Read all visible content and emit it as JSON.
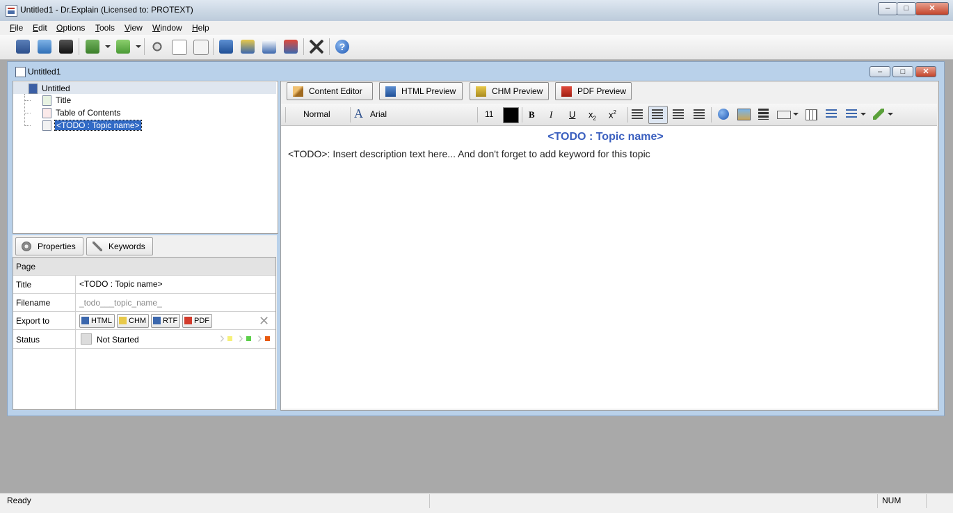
{
  "window": {
    "title": "Untitled1 - Dr.Explain (Licensed to: PROTEXT)"
  },
  "menu": [
    "File",
    "Edit",
    "Options",
    "Tools",
    "View",
    "Window",
    "Help"
  ],
  "toolbar": {
    "icons": [
      "new-project-icon",
      "open-project-icon",
      "save-icon",
      "add-topic-icon",
      "add-child-icon",
      "cut-icon",
      "copy-icon",
      "paste-icon",
      "export-html-icon",
      "export-chm-icon",
      "export-rtf-icon",
      "export-pdf-icon",
      "export-all-icon",
      "settings-icon",
      "help-icon"
    ]
  },
  "child": {
    "title": "Untitled1"
  },
  "tree": {
    "root": "Untitled",
    "items": [
      "Title",
      "Table of Contents",
      "<TODO : Topic name>"
    ]
  },
  "props": {
    "tabs": [
      "Properties",
      "Keywords"
    ],
    "section": "Page",
    "title_key": "Title",
    "title_val": "<TODO : Topic name>",
    "filename_key": "Filename",
    "filename_val": "_todo___topic_name_",
    "export_key": "Export to",
    "export_targets": [
      "HTML",
      "CHM",
      "RTF",
      "PDF"
    ],
    "status_key": "Status",
    "status_val": "Not Started"
  },
  "views": [
    "Content Editor",
    "HTML Preview",
    "CHM Preview",
    "PDF Preview"
  ],
  "format": {
    "style": "Normal",
    "font": "Arial",
    "size": "11",
    "color": "#000000"
  },
  "editor": {
    "heading": "<TODO : Topic name>",
    "body": "<TODO>: Insert description text here... And don't forget to add keyword for this topic",
    "heading_color": "#3a5fbf"
  },
  "status": {
    "text": "Ready",
    "num": "NUM"
  }
}
